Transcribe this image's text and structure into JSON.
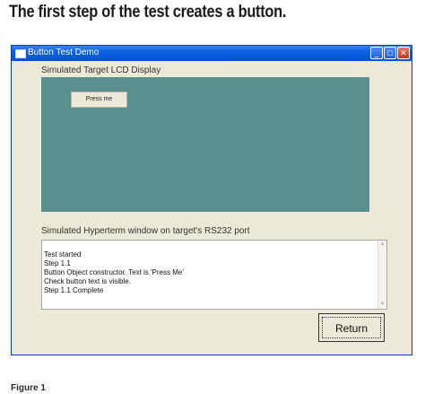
{
  "page": {
    "caption_top": "The first step of the test creates a button.",
    "caption_bottom": "Figure 1"
  },
  "window": {
    "title": "Button Test Demo",
    "minimize_glyph": "_",
    "maximize_glyph": "□",
    "close_glyph": "✕"
  },
  "lcd": {
    "label": "Simulated Target LCD Display",
    "button_label": "Press me",
    "background_color": "#5b8f8e"
  },
  "terminal": {
    "label": "Simulated Hyperterm window on target's RS232 port",
    "lines": [
      "Test started",
      "Step 1.1",
      "Button Object constructor. Text is 'Press Me'",
      "Check button text is visible.",
      "Step 1.1 Complete"
    ]
  },
  "actions": {
    "return_label": "Return"
  },
  "colors": {
    "titlebar": "#0553d4",
    "window_face": "#ece9d8"
  },
  "icons": {
    "title": "window-icon",
    "scroll_up": "scroll-up-arrow-icon",
    "scroll_down": "scroll-down-arrow-icon"
  }
}
